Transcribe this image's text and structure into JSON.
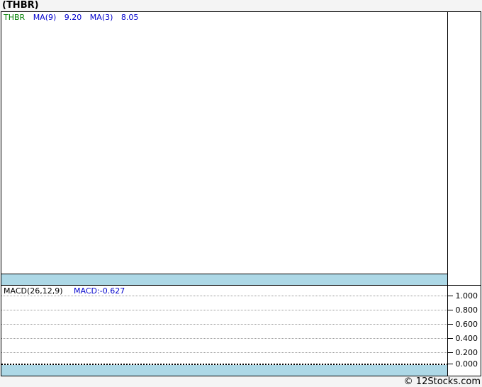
{
  "page": {
    "title": "(THBR)",
    "footer_credit": "© 12Stocks.com"
  },
  "main_chart": {
    "legend": {
      "symbol": "THBR",
      "ma9_label": "MA(9)",
      "ma9_value": "9.20",
      "ma3_label": "MA(3)",
      "ma3_value": "8.05"
    }
  },
  "macd_panel": {
    "indicator_label": "MACD(26,12,9)",
    "indicator_value": "MACD:-0.627",
    "axis_ticks": [
      "1.000",
      "0.800",
      "0.600",
      "0.400",
      "0.200",
      "0.000"
    ]
  },
  "colors": {
    "accent_band": "#ADD8E6",
    "symbol_green": "#008000",
    "value_blue": "#0000CC",
    "grid_gray": "#999999"
  },
  "chart_data": [
    {
      "type": "line",
      "title": "(THBR) price with moving averages",
      "series": [
        {
          "name": "THBR",
          "values": []
        },
        {
          "name": "MA(9)",
          "last_value": 9.2,
          "values": []
        },
        {
          "name": "MA(3)",
          "last_value": 8.05,
          "values": []
        }
      ],
      "legend_position": "top-left",
      "note": "plot area is empty - no visible price data points"
    },
    {
      "type": "line",
      "title": "MACD(26,12,9)",
      "last_value": -0.627,
      "ylim": [
        0.0,
        1.0
      ],
      "yticks": [
        1.0,
        0.8,
        0.6,
        0.4,
        0.2,
        0.0
      ],
      "grid": true,
      "legend_position": "top-left",
      "note": "plot area is empty - no visible MACD series line"
    }
  ]
}
